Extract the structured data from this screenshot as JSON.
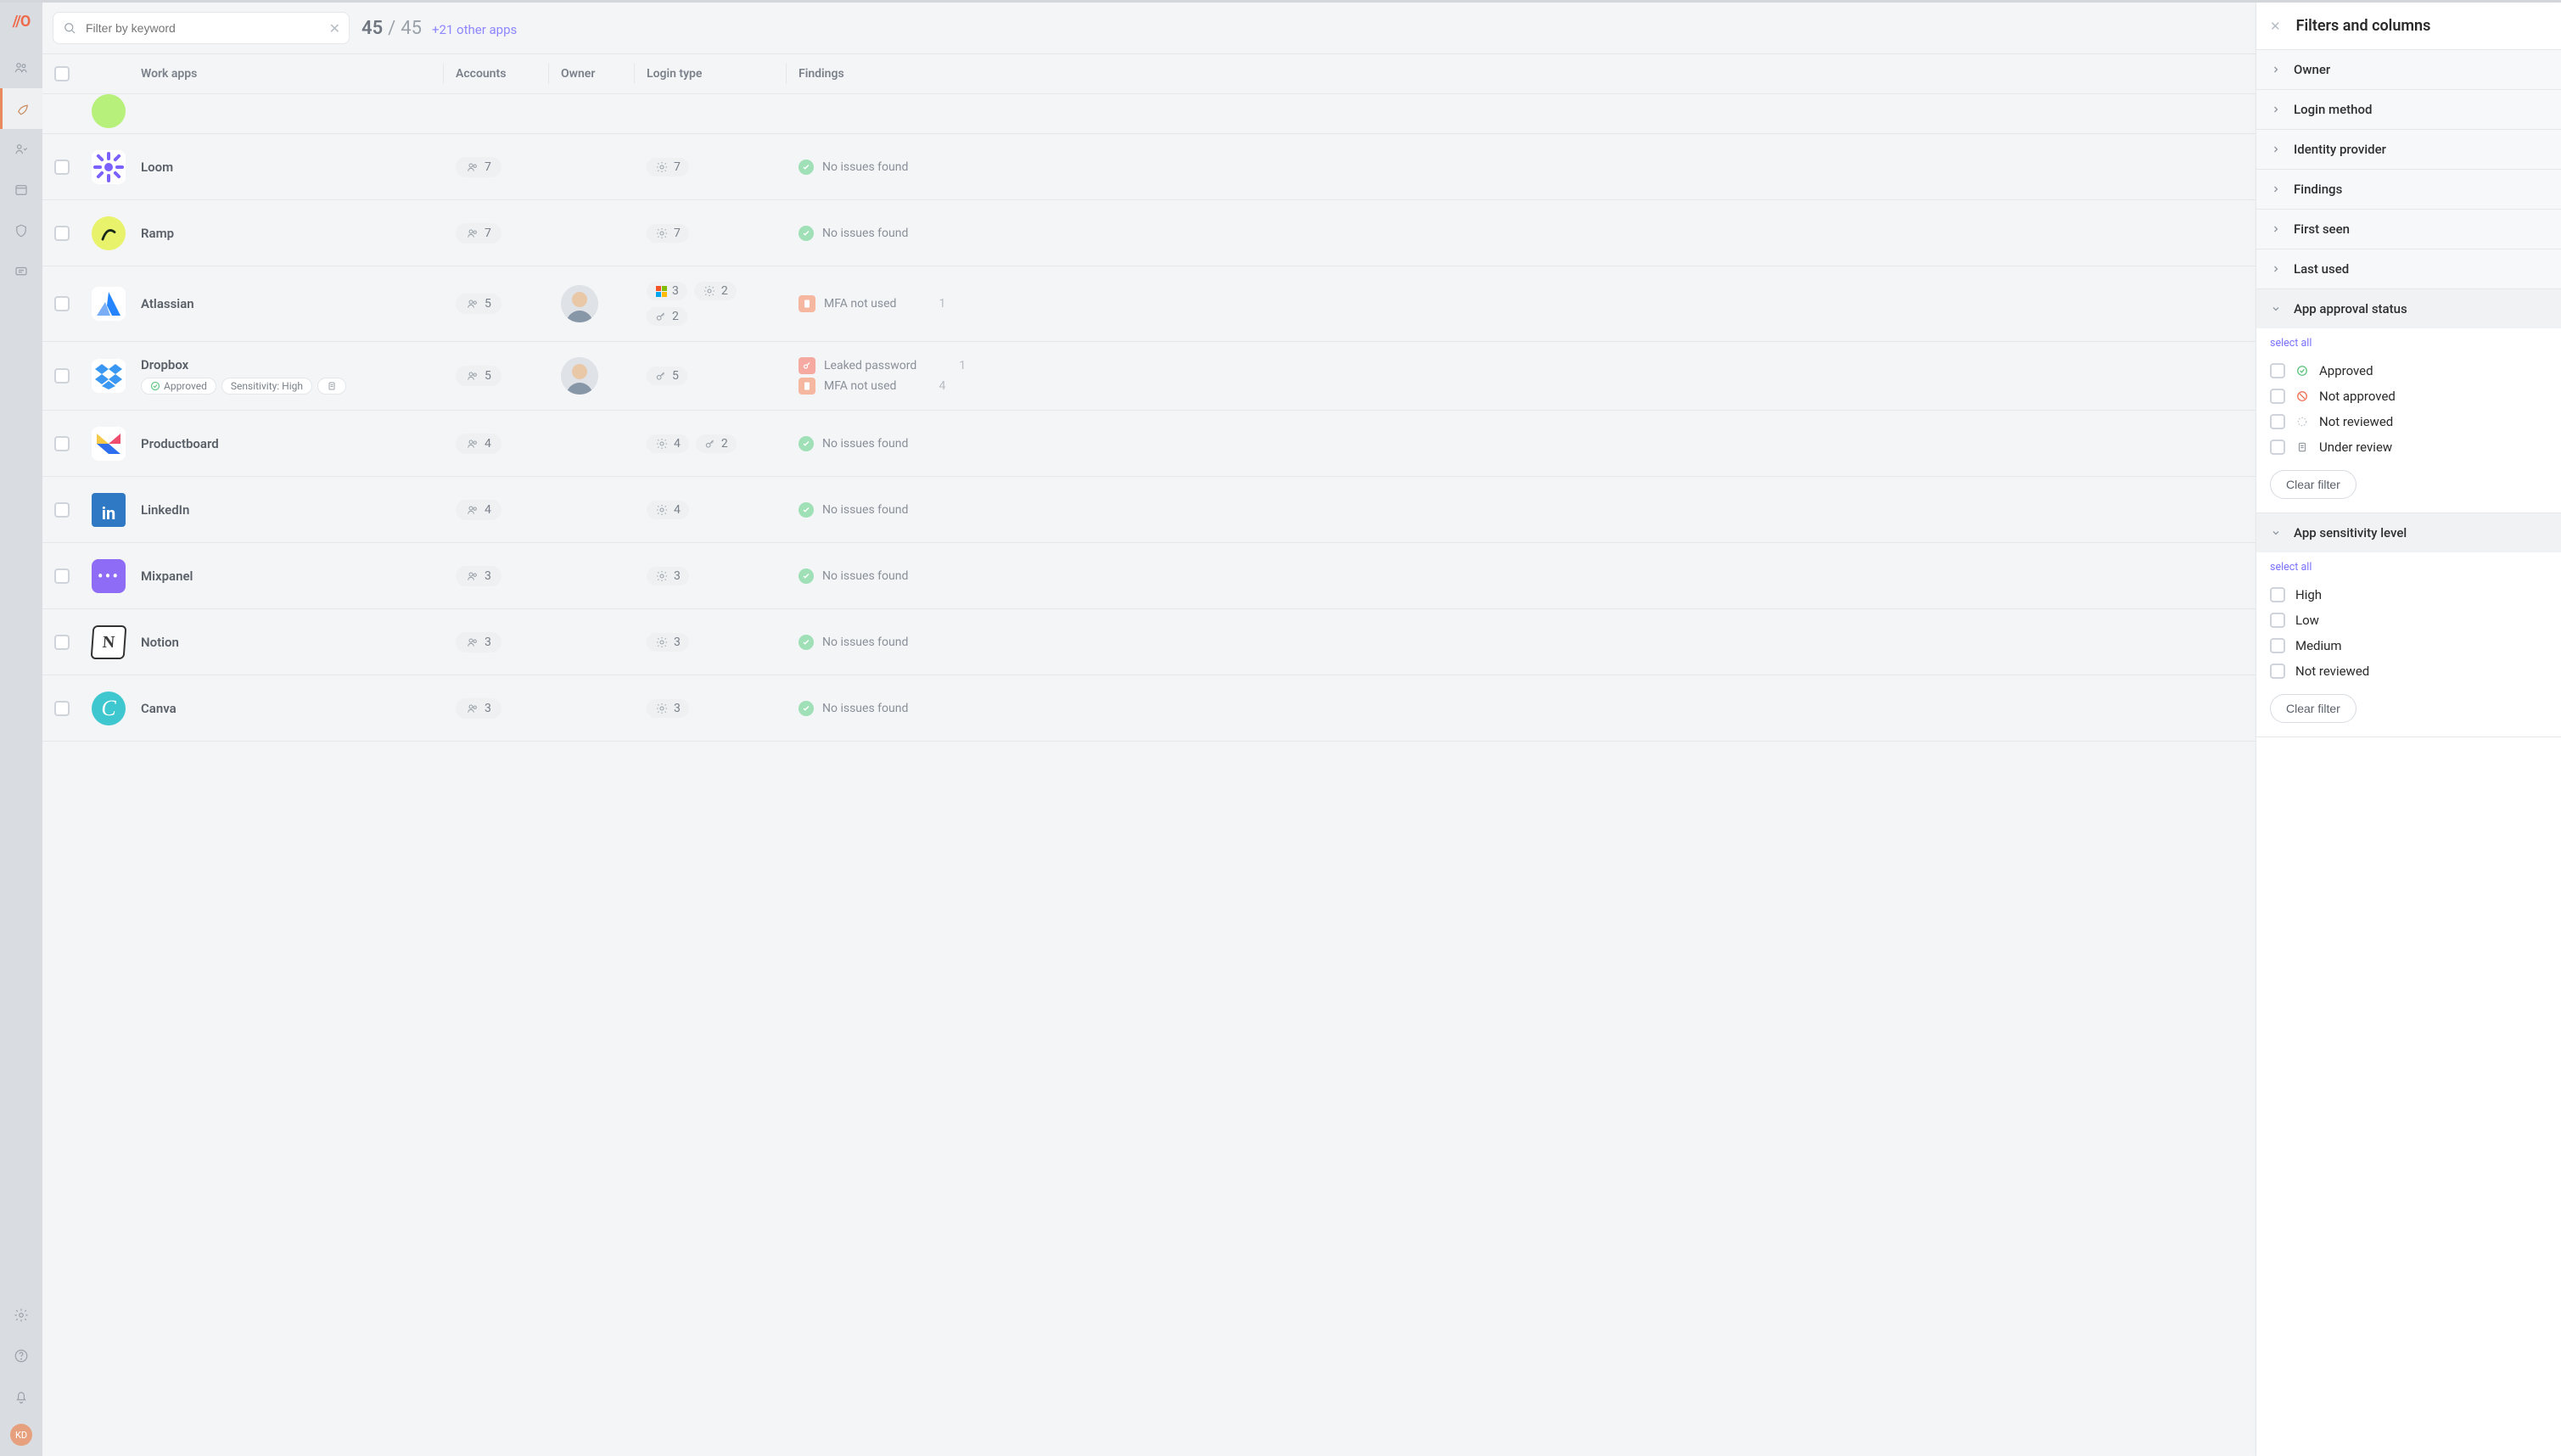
{
  "sidebar": {
    "logo": "//O",
    "avatar": "KD"
  },
  "search": {
    "placeholder": "Filter by keyword"
  },
  "counts": {
    "current": "45",
    "sep": "/",
    "total": "45",
    "other": "+21 other apps"
  },
  "headers": {
    "work_apps": "Work apps",
    "accounts": "Accounts",
    "owner": "Owner",
    "login": "Login type",
    "findings": "Findings"
  },
  "no_issues": "No issues found",
  "mfa_not_used": "MFA not used",
  "leaked_password": "Leaked password",
  "approved_tag": "Approved",
  "sensitivity_high_tag": "Sensitivity: High",
  "apps": [
    {
      "name": "Loom",
      "accounts": "7",
      "owner": null,
      "logins": [
        {
          "t": "gear",
          "v": "7"
        }
      ],
      "findings": [
        {
          "t": "ok"
        }
      ]
    },
    {
      "name": "Ramp",
      "accounts": "7",
      "owner": null,
      "logins": [
        {
          "t": "gear",
          "v": "7"
        }
      ],
      "findings": [
        {
          "t": "ok"
        }
      ]
    },
    {
      "name": "Atlassian",
      "accounts": "5",
      "owner": "a",
      "logins": [
        {
          "t": "ms",
          "v": "3"
        },
        {
          "t": "gear",
          "v": "2"
        },
        {
          "t": "key",
          "v": "2"
        }
      ],
      "findings": [
        {
          "t": "mfa",
          "n": "1"
        }
      ]
    },
    {
      "name": "Dropbox",
      "accounts": "5",
      "owner": "b",
      "logins": [
        {
          "t": "key",
          "v": "5"
        }
      ],
      "findings": [
        {
          "t": "leaked",
          "n": "1"
        },
        {
          "t": "mfa",
          "n": "4"
        }
      ],
      "tags": [
        "approved",
        "sens-high",
        "note"
      ]
    },
    {
      "name": "Productboard",
      "accounts": "4",
      "owner": null,
      "logins": [
        {
          "t": "gear",
          "v": "4"
        },
        {
          "t": "key",
          "v": "2"
        }
      ],
      "findings": [
        {
          "t": "ok"
        }
      ]
    },
    {
      "name": "LinkedIn",
      "accounts": "4",
      "owner": null,
      "logins": [
        {
          "t": "gear",
          "v": "4"
        }
      ],
      "findings": [
        {
          "t": "ok"
        }
      ]
    },
    {
      "name": "Mixpanel",
      "accounts": "3",
      "owner": null,
      "logins": [
        {
          "t": "gear",
          "v": "3"
        }
      ],
      "findings": [
        {
          "t": "ok"
        }
      ]
    },
    {
      "name": "Notion",
      "accounts": "3",
      "owner": null,
      "logins": [
        {
          "t": "gear",
          "v": "3"
        }
      ],
      "findings": [
        {
          "t": "ok"
        }
      ]
    },
    {
      "name": "Canva",
      "accounts": "3",
      "owner": null,
      "logins": [
        {
          "t": "gear",
          "v": "3"
        }
      ],
      "findings": [
        {
          "t": "ok"
        }
      ]
    }
  ],
  "panel": {
    "title": "Filters and columns",
    "sections_collapsed": [
      "Owner",
      "Login method",
      "Identity provider",
      "Findings",
      "First seen",
      "Last used"
    ],
    "status_title": "App approval status",
    "select_all": "select all",
    "status_opts": [
      "Approved",
      "Not approved",
      "Not reviewed",
      "Under review"
    ],
    "clear": "Clear filter",
    "sens_title": "App sensitivity level",
    "sens_opts": [
      "High",
      "Low",
      "Medium",
      "Not reviewed"
    ]
  }
}
